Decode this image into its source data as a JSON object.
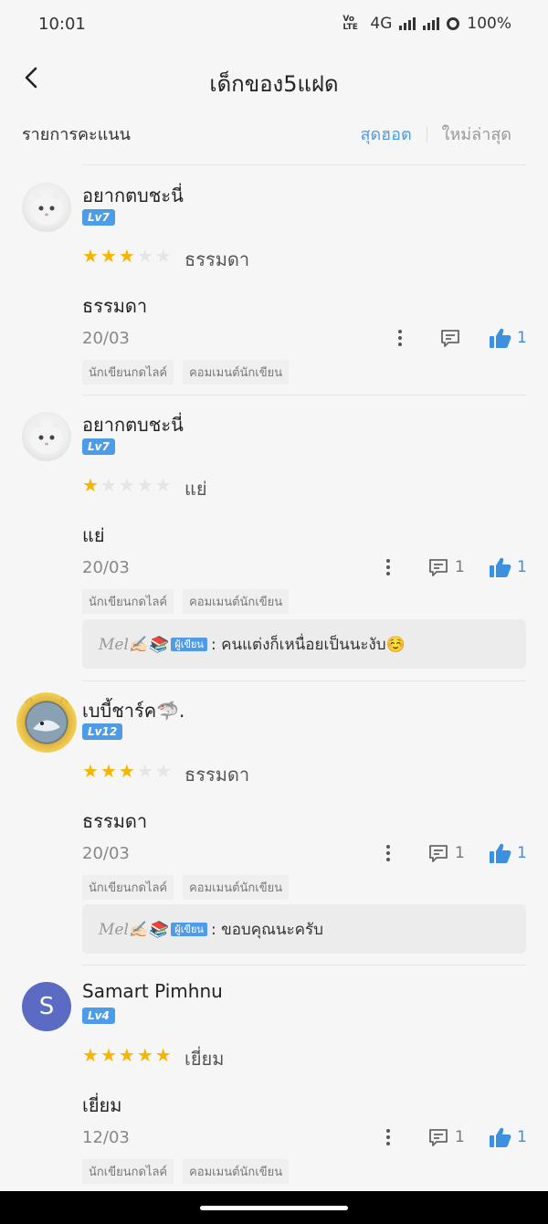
{
  "status_bar": {
    "time": "10:01",
    "volte": "Vo LTE",
    "lte_num": "1\n2",
    "network": "4G",
    "battery": "100%"
  },
  "header": {
    "back_icon": "chevron-left-icon",
    "title": "เด็กของ5แฝด"
  },
  "sort_bar": {
    "label": "รายการคะแนน",
    "tab_hot": "สุดฮอต",
    "tab_new": "ใหม่ล่าสุด",
    "active_color": "#4a9de6"
  },
  "reviews": [
    {
      "username": "อยากตบชะนี่",
      "level": "Lv7",
      "stars": 3,
      "rating_label": "ธรรมดา",
      "text": "ธรรมดา",
      "date": "20/03",
      "comment_count": "",
      "like_count": "1",
      "tag1": "นักเขียนกดไลค์",
      "tag2": "คอมเมนต์นักเขียน"
    },
    {
      "username": "อยากตบชะนี่",
      "level": "Lv7",
      "stars": 1,
      "rating_label": "แย่",
      "text": "แย่",
      "date": "20/03",
      "comment_count": "1",
      "like_count": "1",
      "tag1": "นักเขียนกดไลค์",
      "tag2": "คอมเมนต์นักเขียน",
      "reply": {
        "author": "Mel✍🏻📚",
        "author_tag": "ผู้เขียน",
        "text": " : คนแต่งก็เหนื่อยเป็นนะงับ☺️"
      }
    },
    {
      "username": "เบบี้ชาร์ค🦈.",
      "level": "Lv12",
      "stars": 3,
      "rating_label": "ธรรมดา",
      "text": "ธรรมดา",
      "date": "20/03",
      "comment_count": "1",
      "like_count": "1",
      "tag1": "นักเขียนกดไลค์",
      "tag2": "คอมเมนต์นักเขียน",
      "reply": {
        "author": "Mel✍🏻📚",
        "author_tag": "ผู้เขียน",
        "text": " : ขอบคุณนะครับ"
      }
    },
    {
      "username": "Samart Pimhnu",
      "avatar_letter": "S",
      "level": "Lv4",
      "stars": 5,
      "rating_label": "เยี่ยม",
      "text": "เยี่ยม",
      "date": "12/03",
      "comment_count": "1",
      "like_count": "1",
      "tag1": "นักเขียนกดไลค์",
      "tag2": "คอมเมนต์นักเขียน"
    }
  ],
  "icons": {
    "more": "more-vertical-icon",
    "comment": "comment-icon",
    "like": "thumbs-up-icon",
    "star": "star-icon"
  },
  "colors": {
    "like_blue": "#3d8fe0",
    "star_gold": "#f7b500",
    "level_badge": "#4e9be8",
    "avatar_s": "#5b6bc4"
  }
}
